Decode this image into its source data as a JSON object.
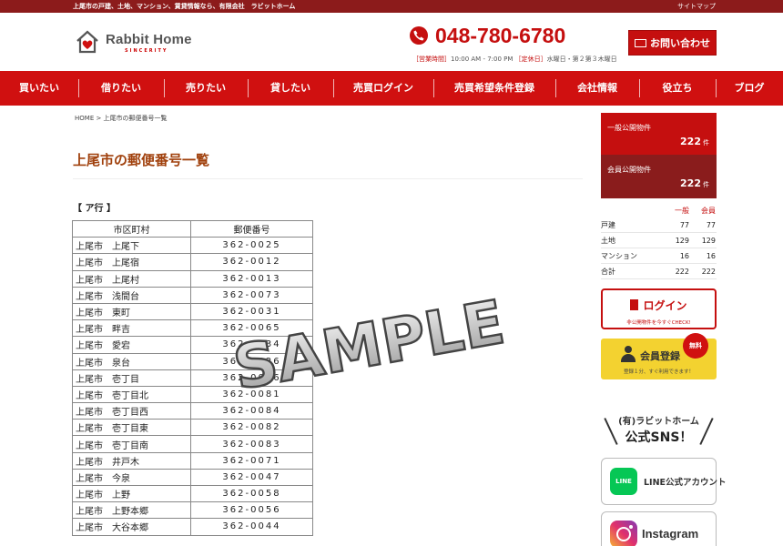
{
  "topbar": {
    "tagline": "上尾市の戸建、土地、マンション、賃貸情報なら、有限会社　ラビットホーム",
    "sitemap": "サイトマップ"
  },
  "header": {
    "logo_name": "Rabbit Home",
    "logo_sub": "SINCERITY",
    "phone": "048-780-6780",
    "hours_label1": "［営業時間］",
    "hours_value1": "10:00 AM - 7:00 PM",
    "hours_label2": "［定休日］",
    "hours_value2": "水曜日・第２第３木曜日",
    "contact_label": "お問い合わせ",
    "brand_color": "#c50f0f"
  },
  "nav": {
    "items": [
      "買いたい",
      "借りたい",
      "売りたい",
      "貸したい",
      "売買ログイン",
      "売買希望条件登録",
      "会社情報",
      "役立ち",
      "ブログ"
    ]
  },
  "breadcrumb": "HOME > 上尾市の郵便番号一覧",
  "page_title": "上尾市の郵便番号一覧",
  "section_label": "【 ア行 】",
  "table": {
    "headers": [
      "市区町村",
      "郵便番号"
    ],
    "rows": [
      [
        "上尾市　上尾下",
        "362-0025"
      ],
      [
        "上尾市　上尾宿",
        "362-0012"
      ],
      [
        "上尾市　上尾村",
        "362-0013"
      ],
      [
        "上尾市　浅間台",
        "362-0073"
      ],
      [
        "上尾市　東町",
        "362-0031"
      ],
      [
        "上尾市　畔吉",
        "362-0065"
      ],
      [
        "上尾市　愛宕",
        "362-0034"
      ],
      [
        "上尾市　泉台",
        "362-0026"
      ],
      [
        "上尾市　壱丁目",
        "362-0046"
      ],
      [
        "上尾市　壱丁目北",
        "362-0081"
      ],
      [
        "上尾市　壱丁目西",
        "362-0084"
      ],
      [
        "上尾市　壱丁目東",
        "362-0082"
      ],
      [
        "上尾市　壱丁目南",
        "362-0083"
      ],
      [
        "上尾市　井戸木",
        "362-0071"
      ],
      [
        "上尾市　今泉",
        "362-0047"
      ],
      [
        "上尾市　上野",
        "362-0058"
      ],
      [
        "上尾市　上野本郷",
        "362-0056"
      ],
      [
        "上尾市　大谷本郷",
        "362-0044"
      ]
    ]
  },
  "sidebar": {
    "general": {
      "title": "一般公開物件",
      "count": "222",
      "unit": "件"
    },
    "member": {
      "title": "会員公開物件",
      "count": "222",
      "unit": "件"
    },
    "stats": {
      "headers": [
        "一般",
        "会員"
      ],
      "rows": [
        [
          "戸建",
          "77",
          "77"
        ],
        [
          "土地",
          "129",
          "129"
        ],
        [
          "マンション",
          "16",
          "16"
        ],
        [
          "合計",
          "222",
          "222"
        ]
      ]
    },
    "login": {
      "title": "ログイン",
      "sub": "非公開物件を今すぐCHECK!"
    },
    "register": {
      "title": "会員登録",
      "sub": "登録１分、すぐ利用できます！",
      "badge": "無料"
    },
    "sns": {
      "heading1": "(有)ラビットホーム",
      "heading2": "公式SNS！",
      "line_icon": "LINE",
      "line_label": "LINE公式アカウント",
      "insta_label": "Instagram"
    }
  },
  "watermark": "SAMPLE"
}
